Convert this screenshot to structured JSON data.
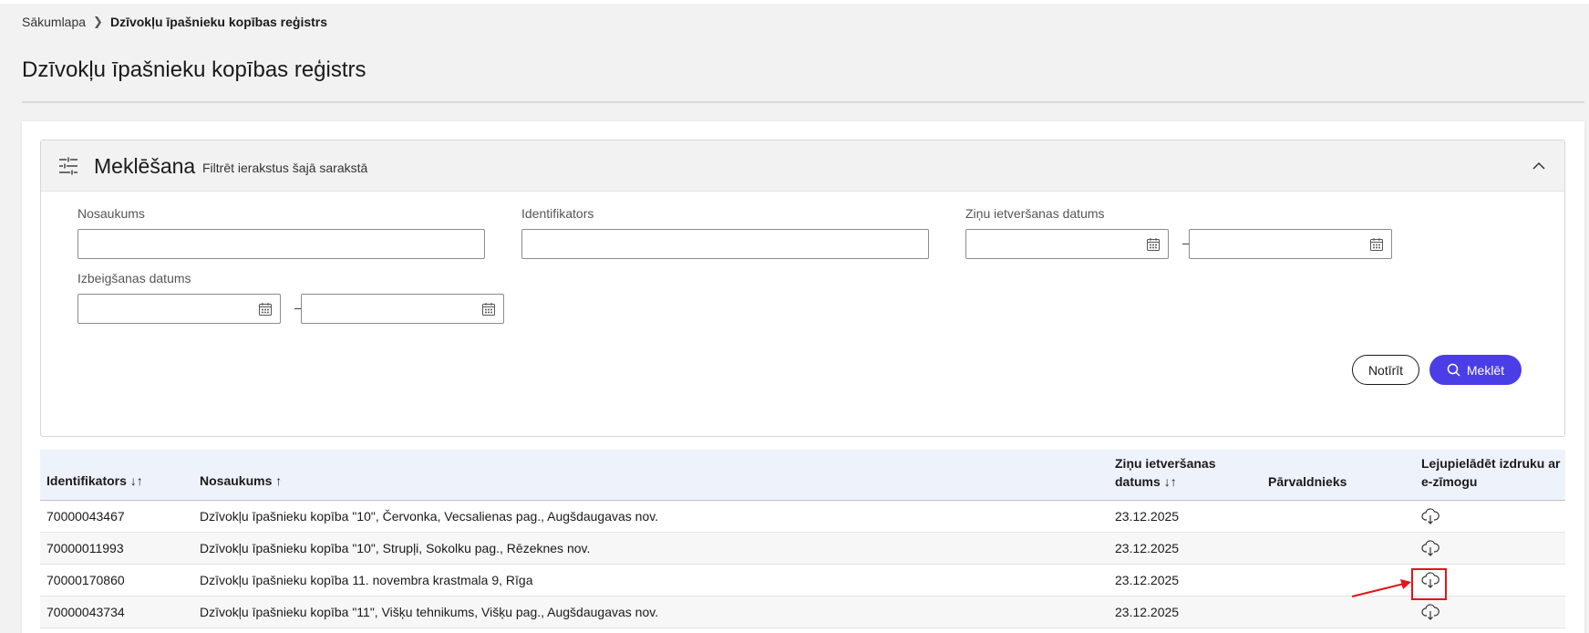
{
  "breadcrumb": {
    "home": "Sākumlapa",
    "current": "Dzīvokļu īpašnieku kopības reģistrs"
  },
  "page": {
    "title": "Dzīvokļu īpašnieku kopības reģistrs"
  },
  "search": {
    "title": "Meklēšana",
    "subtitle": "Filtrēt ierakstus šajā sarakstā",
    "fields": {
      "name_label": "Nosaukums",
      "name_value": "",
      "id_label": "Identifikators",
      "id_value": "",
      "filing_date_label": "Ziņu ietveršanas datums",
      "end_date_label": "Izbeigšanas datums",
      "range_separator": "–"
    },
    "clear_label": "Notīrīt",
    "search_label": "Meklēt"
  },
  "table": {
    "headers": {
      "id": "Identifikators",
      "id_sort": "↓↑",
      "name": "Nosaukums",
      "name_sort": "↑",
      "date_line1": "Ziņu ietveršanas",
      "date_line2": "datums",
      "date_sort": "↓↑",
      "manager": "Pārvaldnieks",
      "download_line1": "Lejupielādēt izdruku ar",
      "download_line2": "e-zīmogu"
    },
    "rows": [
      {
        "id": "70000043467",
        "name": "Dzīvokļu īpašnieku kopība \"10\", Červonka, Vecsalienas pag., Augšdaugavas nov.",
        "date": "23.12.2025",
        "manager": ""
      },
      {
        "id": "70000011993",
        "name": "Dzīvokļu īpašnieku kopība \"10\", Strupļi, Sokolku pag., Rēzeknes nov.",
        "date": "23.12.2025",
        "manager": ""
      },
      {
        "id": "70000170860",
        "name": "Dzīvokļu īpašnieku kopība 11. novembra krastmala 9, Rīga",
        "date": "23.12.2025",
        "manager": ""
      },
      {
        "id": "70000043734",
        "name": "Dzīvokļu īpašnieku kopība \"11\", Višķu tehnikums, Višķu pag., Augšdaugavas nov.",
        "date": "23.12.2025",
        "manager": ""
      }
    ]
  },
  "icons": {
    "filter": "sliders-icon",
    "collapse": "chevron-up-icon",
    "calendar": "calendar-icon",
    "search": "search-icon",
    "download": "cloud-download-icon"
  },
  "colors": {
    "primary": "#4b3ee6",
    "header_bg": "#eef3fb",
    "highlight": "#e0161b"
  }
}
